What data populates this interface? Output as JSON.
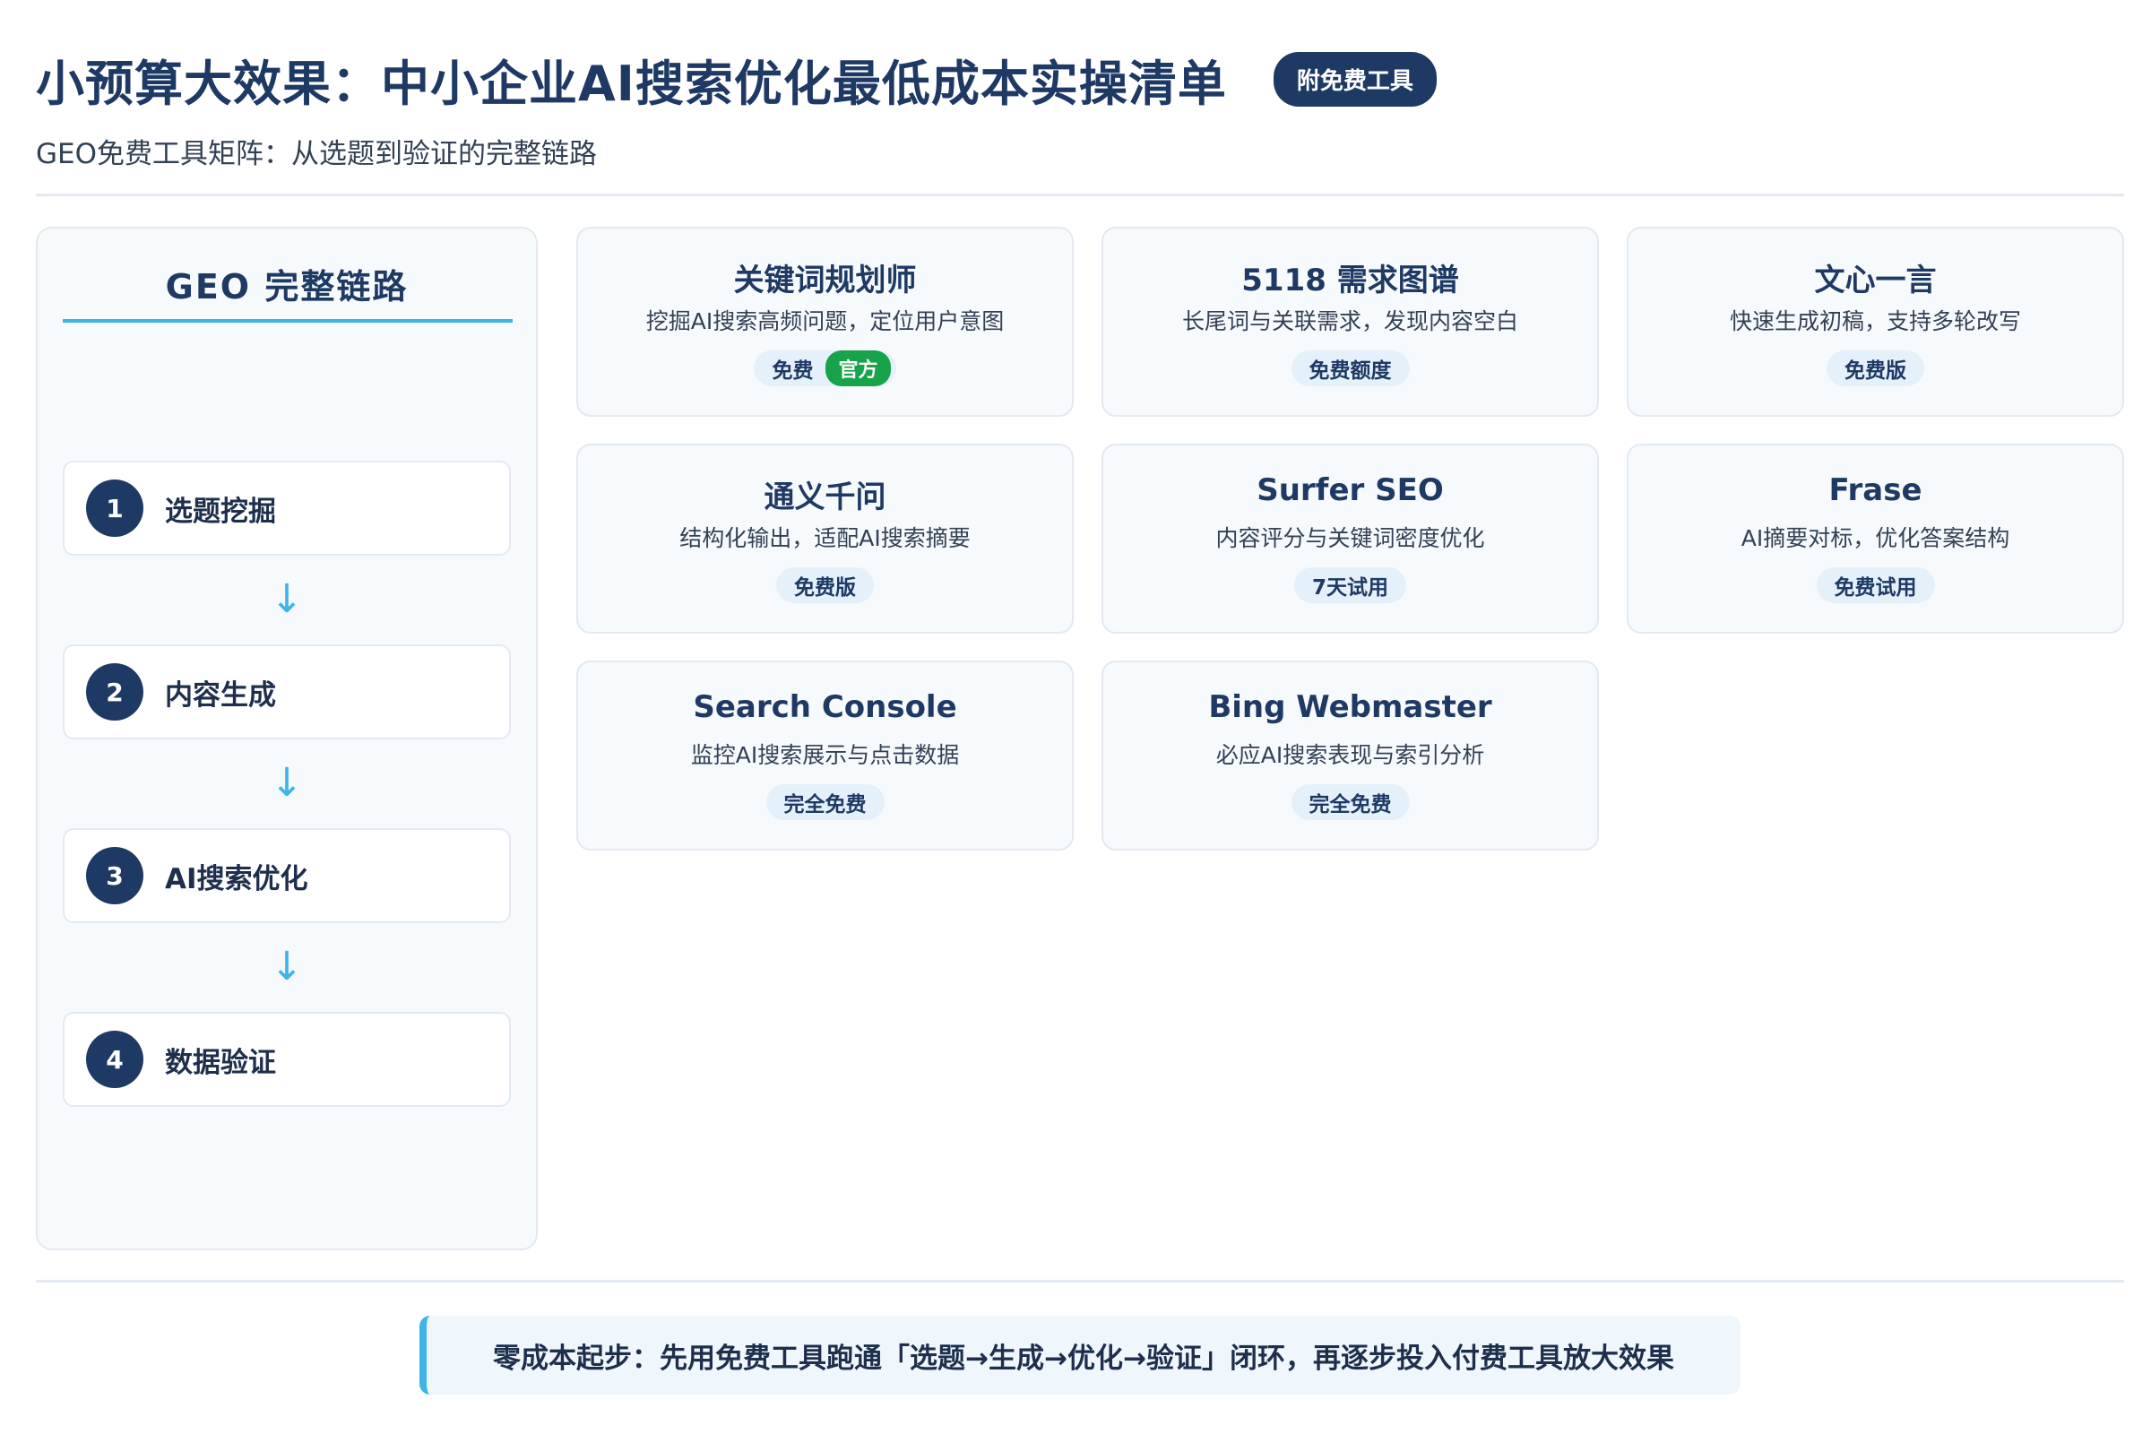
{
  "header": {
    "title": "小预算大效果：中小企业AI搜索优化最低成本实操清单",
    "badge": "附免费工具",
    "subtitle": "GEO免费工具矩阵：从选题到验证的完整链路"
  },
  "flow": {
    "title": "GEO 完整链路",
    "arrow": "↓",
    "steps": [
      {
        "num": "1",
        "label": "选题挖掘"
      },
      {
        "num": "2",
        "label": "内容生成"
      },
      {
        "num": "3",
        "label": "AI搜索优化"
      },
      {
        "num": "4",
        "label": "数据验证"
      }
    ]
  },
  "tools": [
    {
      "name": "关键词规划师",
      "desc": "挖掘AI搜索高频问题，定位用户意图",
      "tag": "免费",
      "extra_tag": "官方"
    },
    {
      "name": "5118 需求图谱",
      "desc": "长尾词与关联需求，发现内容空白",
      "tag": "免费额度"
    },
    {
      "name": "文心一言",
      "desc": "快速生成初稿，支持多轮改写",
      "tag": "免费版"
    },
    {
      "name": "通义千问",
      "desc": "结构化输出，适配AI搜索摘要",
      "tag": "免费版"
    },
    {
      "name": "Surfer SEO",
      "desc": "内容评分与关键词密度优化",
      "tag": "7天试用"
    },
    {
      "name": "Frase",
      "desc": "AI摘要对标，优化答案结构",
      "tag": "免费试用"
    },
    {
      "name": "Search Console",
      "desc": "监控AI搜索展示与点击数据",
      "tag": "完全免费"
    },
    {
      "name": "Bing Webmaster",
      "desc": "必应AI搜索表现与索引分析",
      "tag": "完全免费"
    }
  ],
  "footer": {
    "text": "零成本起步：先用免费工具跑通「选题→生成→优化→验证」闭环，再逐步投入付费工具放大效果"
  },
  "colors": {
    "primary": "#1e3a64",
    "accent": "#3fb4e8",
    "green": "#16a34a",
    "card_bg": "#f7fafd",
    "tag_bg": "#e4f1fb"
  }
}
